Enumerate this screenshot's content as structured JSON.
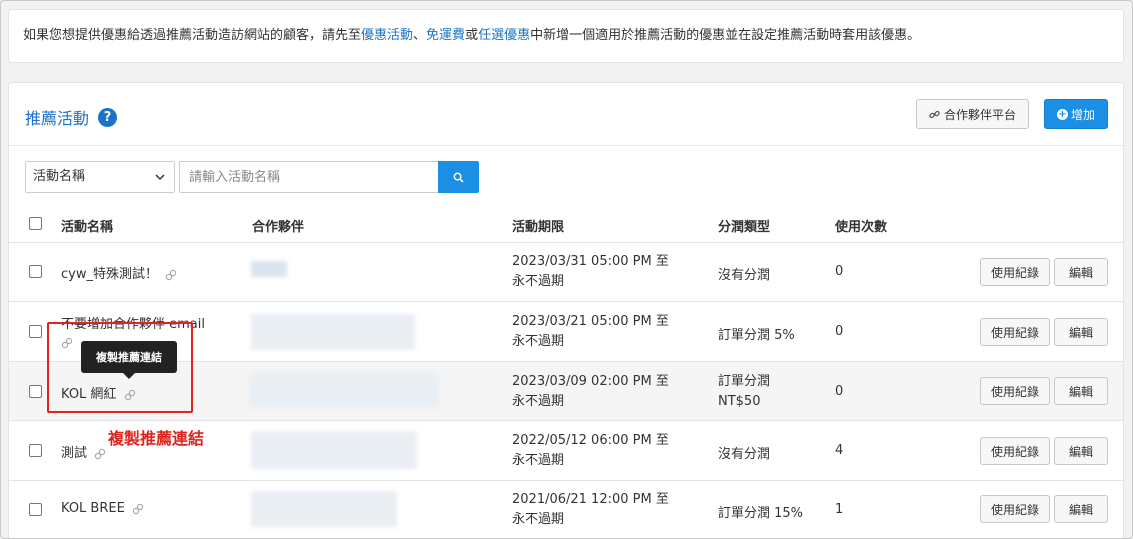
{
  "notice": {
    "prefix": "如果您想提供優惠給透過推薦活動造訪網站的顧客，請先至",
    "link1": "優惠活動",
    "sep1": "、",
    "link2": "免運費",
    "sep2": "或",
    "link3": "任選優惠",
    "suffix": "中新增一個適用於推薦活動的優惠並在設定推薦活動時套用該優惠。"
  },
  "header": {
    "title": "推薦活動",
    "help": "?",
    "partner_button": "合作夥伴平台",
    "add_button": "增加"
  },
  "search": {
    "select_value": "活動名稱",
    "placeholder": "請輸入活動名稱"
  },
  "table": {
    "columns": [
      "活動名稱",
      "合作夥伴",
      "活動期限",
      "分潤類型",
      "使用次數"
    ],
    "rows": [
      {
        "name": "cyw_特殊測試！",
        "date_line1": "2023/03/31 05:00 PM 至",
        "date_line2": "永不過期",
        "commission": "沒有分潤",
        "usage": "0"
      },
      {
        "name": "不要增加合作夥伴 email",
        "date_line1": "2023/03/21 05:00 PM 至",
        "date_line2": "永不過期",
        "commission": "訂單分潤 5%",
        "usage": "0"
      },
      {
        "name": "KOL 網紅",
        "date_line1": "2023/03/09 02:00 PM 至",
        "date_line2": "永不過期",
        "commission": "訂單分潤",
        "commission2": "NT$50",
        "usage": "0"
      },
      {
        "name": "測試",
        "date_line1": "2022/05/12 06:00 PM 至",
        "date_line2": "永不過期",
        "commission": "沒有分潤",
        "usage": "4"
      },
      {
        "name": "KOL BREE",
        "date_line1": "2021/06/21 12:00 PM 至",
        "date_line2": "永不過期",
        "commission": "訂單分潤 15%",
        "usage": "1"
      }
    ],
    "usage_log_button": "使用紀錄",
    "edit_button": "編輯"
  },
  "tooltip": "複製推薦連結",
  "annotation": "複製推薦連結",
  "colors": {
    "accent": "#1a73c7",
    "primary_button": "#1a8fe3",
    "annotation": "#e0231d"
  }
}
